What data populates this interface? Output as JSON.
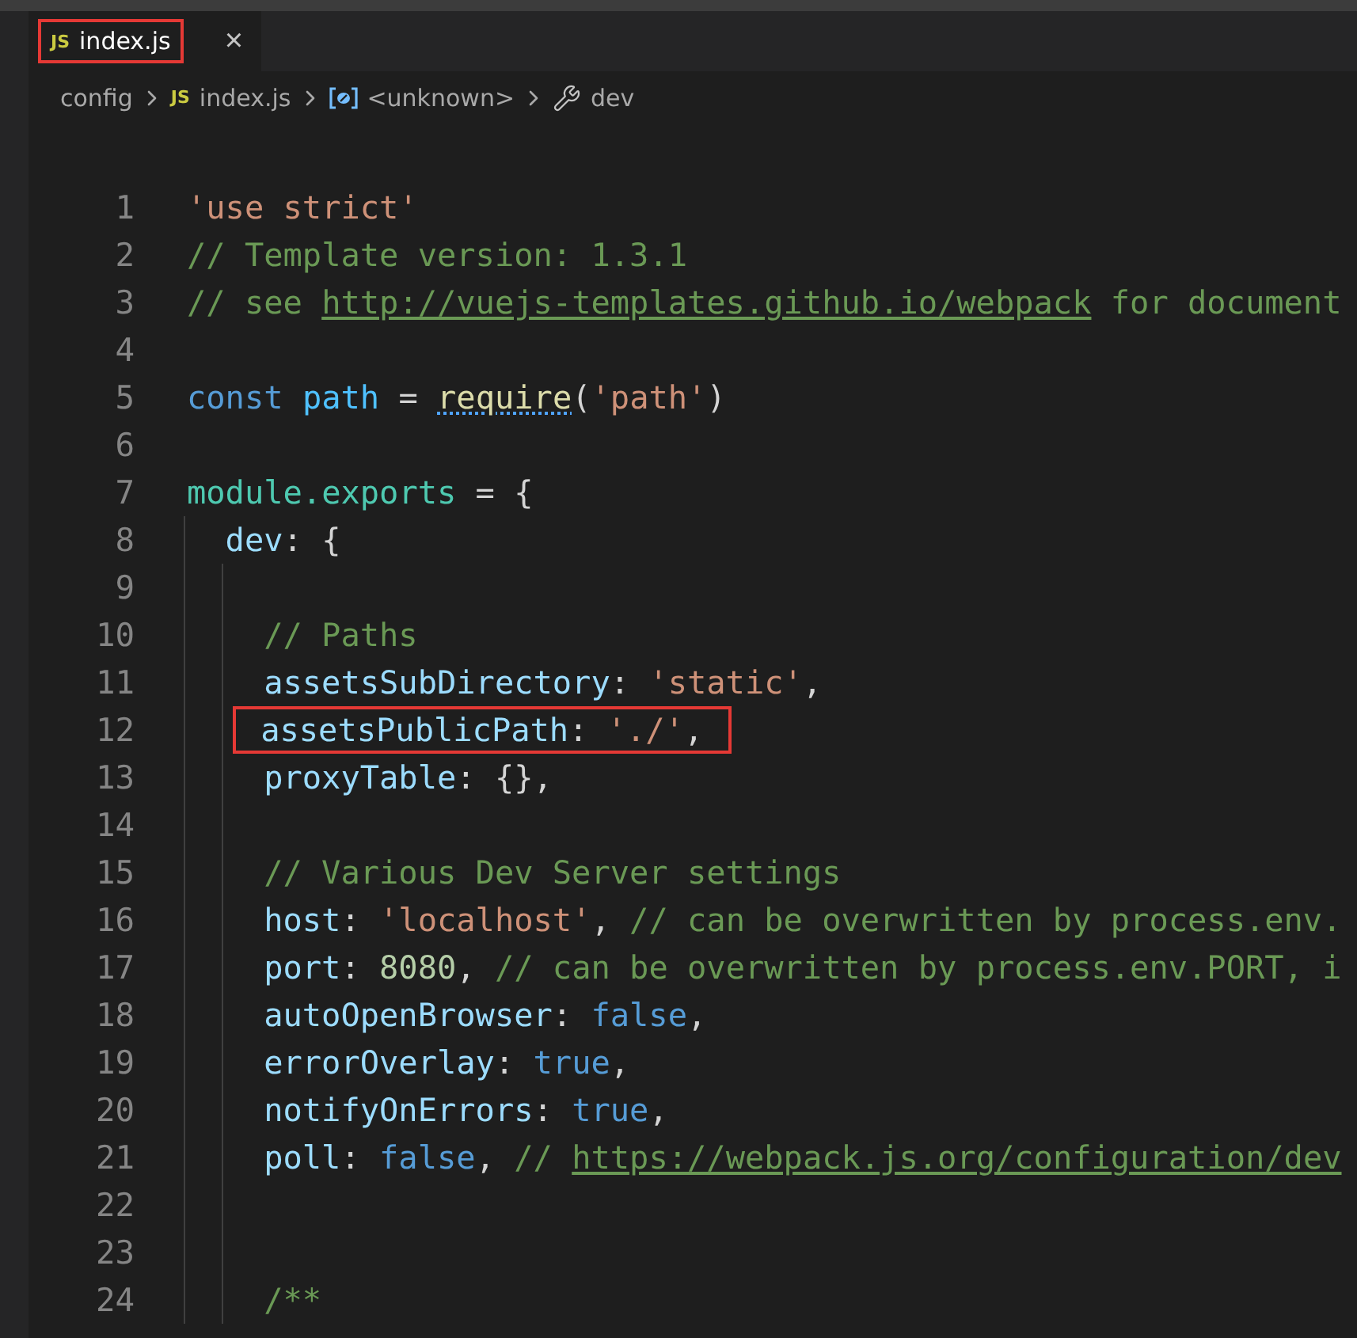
{
  "tabs": [
    {
      "icon_text": "JS",
      "label": "index.js",
      "close": "×",
      "selected": true,
      "highlighted": true
    }
  ],
  "breadcrumb": [
    {
      "kind": "folder",
      "label": "config"
    },
    {
      "kind": "file",
      "icon_text": "JS",
      "label": "index.js"
    },
    {
      "kind": "symbol",
      "label": "<unknown>"
    },
    {
      "kind": "property",
      "label": "dev"
    }
  ],
  "code": {
    "lines": [
      {
        "number": "1",
        "tokens": [
          {
            "kind": "string",
            "text": "'use strict'"
          }
        ]
      },
      {
        "number": "2",
        "tokens": [
          {
            "kind": "comment",
            "text": "// Template version: 1.3.1"
          }
        ]
      },
      {
        "number": "3",
        "tokens": [
          {
            "kind": "comment",
            "text": "// see "
          },
          {
            "kind": "link",
            "text": "http://vuejs-templates.github.io/webpack"
          },
          {
            "kind": "comment",
            "text": " for document"
          }
        ]
      },
      {
        "number": "4"
      },
      {
        "number": "5",
        "tokens": [
          {
            "kind": "keyword",
            "text": "const "
          },
          {
            "kind": "constant",
            "text": "path"
          },
          {
            "kind": "plain",
            "text": " = "
          },
          {
            "kind": "function",
            "text": "require"
          },
          {
            "kind": "plain",
            "text": "("
          },
          {
            "kind": "string",
            "text": "'path'"
          },
          {
            "kind": "plain",
            "text": ")"
          }
        ]
      },
      {
        "number": "6"
      },
      {
        "number": "7",
        "tokens": [
          {
            "kind": "type",
            "text": "module.exports"
          },
          {
            "kind": "plain",
            "text": " = {"
          }
        ],
        "children": [
          {
            "number": "8",
            "tokens": [
              {
                "kind": "property",
                "text": "dev"
              },
              {
                "kind": "plain",
                "text": ": {"
              }
            ],
            "children": [
              {
                "number": "9"
              },
              {
                "number": "10",
                "tokens": [
                  {
                    "kind": "comment",
                    "text": "// Paths"
                  }
                ]
              },
              {
                "number": "11",
                "tokens": [
                  {
                    "kind": "property",
                    "text": "assetsSubDirectory"
                  },
                  {
                    "kind": "plain",
                    "text": ": "
                  },
                  {
                    "kind": "string",
                    "text": "'static'"
                  },
                  {
                    "kind": "plain",
                    "text": ","
                  }
                ]
              },
              {
                "number": "12",
                "highlighted": true,
                "tokens": [
                  {
                    "kind": "property",
                    "text": "assetsPublicPath"
                  },
                  {
                    "kind": "plain",
                    "text": ": "
                  },
                  {
                    "kind": "string",
                    "text": "'./'"
                  },
                  {
                    "kind": "plain",
                    "text": ","
                  }
                ]
              },
              {
                "number": "13",
                "tokens": [
                  {
                    "kind": "property",
                    "text": "proxyTable"
                  },
                  {
                    "kind": "plain",
                    "text": ": {},"
                  }
                ]
              },
              {
                "number": "14"
              },
              {
                "number": "15",
                "tokens": [
                  {
                    "kind": "comment",
                    "text": "// Various Dev Server settings"
                  }
                ]
              },
              {
                "number": "16",
                "tokens": [
                  {
                    "kind": "property",
                    "text": "host"
                  },
                  {
                    "kind": "plain",
                    "text": ": "
                  },
                  {
                    "kind": "string",
                    "text": "'localhost'"
                  },
                  {
                    "kind": "plain",
                    "text": ", "
                  },
                  {
                    "kind": "comment",
                    "text": "// can be overwritten by process.env."
                  }
                ]
              },
              {
                "number": "17",
                "tokens": [
                  {
                    "kind": "property",
                    "text": "port"
                  },
                  {
                    "kind": "plain",
                    "text": ": "
                  },
                  {
                    "kind": "number",
                    "text": "8080"
                  },
                  {
                    "kind": "plain",
                    "text": ", "
                  },
                  {
                    "kind": "comment",
                    "text": "// can be overwritten by process.env.PORT, i"
                  }
                ]
              },
              {
                "number": "18",
                "tokens": [
                  {
                    "kind": "property",
                    "text": "autoOpenBrowser"
                  },
                  {
                    "kind": "plain",
                    "text": ": "
                  },
                  {
                    "kind": "keyword",
                    "text": "false"
                  },
                  {
                    "kind": "plain",
                    "text": ","
                  }
                ]
              },
              {
                "number": "19",
                "tokens": [
                  {
                    "kind": "property",
                    "text": "errorOverlay"
                  },
                  {
                    "kind": "plain",
                    "text": ": "
                  },
                  {
                    "kind": "keyword",
                    "text": "true"
                  },
                  {
                    "kind": "plain",
                    "text": ","
                  }
                ]
              },
              {
                "number": "20",
                "tokens": [
                  {
                    "kind": "property",
                    "text": "notifyOnErrors"
                  },
                  {
                    "kind": "plain",
                    "text": ": "
                  },
                  {
                    "kind": "keyword",
                    "text": "true"
                  },
                  {
                    "kind": "plain",
                    "text": ","
                  }
                ]
              },
              {
                "number": "21",
                "tokens": [
                  {
                    "kind": "property",
                    "text": "poll"
                  },
                  {
                    "kind": "plain",
                    "text": ": "
                  },
                  {
                    "kind": "keyword",
                    "text": "false"
                  },
                  {
                    "kind": "plain",
                    "text": ", "
                  },
                  {
                    "kind": "comment",
                    "text": "// "
                  },
                  {
                    "kind": "link",
                    "text": "https://webpack.js.org/configuration/dev"
                  }
                ]
              },
              {
                "number": "22"
              },
              {
                "number": "23"
              },
              {
                "number": "24",
                "tokens": [
                  {
                    "kind": "comment",
                    "text": "/**"
                  }
                ]
              }
            ]
          }
        ]
      }
    ]
  }
}
